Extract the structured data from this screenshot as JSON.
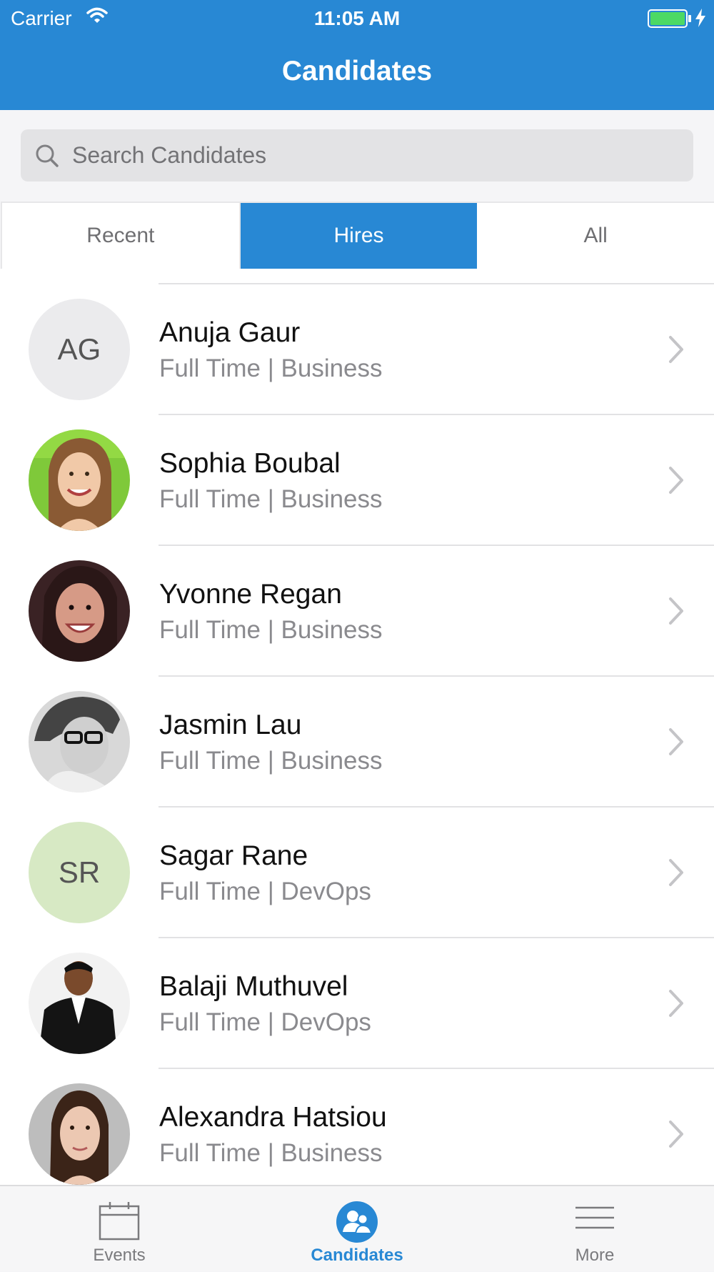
{
  "status_bar": {
    "carrier": "Carrier",
    "time": "11:05 AM",
    "battery_color": "#4cd964"
  },
  "header": {
    "title": "Candidates",
    "color": "#2888d4"
  },
  "search": {
    "placeholder": "Search Candidates",
    "value": ""
  },
  "tabs": [
    {
      "label": "Recent",
      "active": false
    },
    {
      "label": "Hires",
      "active": true
    },
    {
      "label": "All",
      "active": false
    }
  ],
  "candidates": [
    {
      "name": "Anuja Gaur",
      "detail": "Full Time | Business",
      "initials": "AG",
      "avatar": "initials-gray"
    },
    {
      "name": "Sophia Boubal",
      "detail": "Full Time | Business",
      "avatar": "photo"
    },
    {
      "name": "Yvonne Regan",
      "detail": "Full Time | Business",
      "avatar": "photo"
    },
    {
      "name": "Jasmin Lau",
      "detail": "Full Time | Business",
      "avatar": "photo"
    },
    {
      "name": "Sagar Rane",
      "detail": "Full Time | DevOps",
      "initials": "SR",
      "avatar": "initials-green"
    },
    {
      "name": "Balaji Muthuvel",
      "detail": "Full Time | DevOps",
      "avatar": "photo"
    },
    {
      "name": "Alexandra Hatsiou",
      "detail": "Full Time | Business",
      "avatar": "photo"
    }
  ],
  "tabbar": [
    {
      "label": "Events",
      "icon": "calendar-icon",
      "active": false
    },
    {
      "label": "Candidates",
      "icon": "candidates-icon",
      "active": true
    },
    {
      "label": "More",
      "icon": "menu-icon",
      "active": false
    }
  ]
}
